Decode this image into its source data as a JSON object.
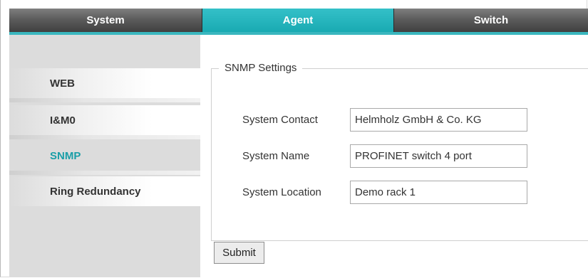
{
  "tabs": [
    {
      "label": "System"
    },
    {
      "label": "Agent",
      "active": true
    },
    {
      "label": "Switch"
    }
  ],
  "sidebar": {
    "items": [
      {
        "label": "WEB"
      },
      {
        "label": "I&M0"
      },
      {
        "label": "SNMP",
        "active": true
      },
      {
        "label": "Ring Redundancy"
      }
    ]
  },
  "snmp": {
    "legend": "SNMP Settings",
    "fields": [
      {
        "label": "System Contact",
        "value": "Helmholz GmbH & Co. KG"
      },
      {
        "label": "System Name",
        "value": "PROFINET switch 4 port"
      },
      {
        "label": "System Location",
        "value": "Demo rack 1"
      }
    ],
    "submit_label": "Submit"
  },
  "colors": {
    "accent": "#1aabb3",
    "tab_dark": "#4a4a4a",
    "sidebar_bg": "#dcdcdc",
    "active_link": "#1a9ea7"
  }
}
